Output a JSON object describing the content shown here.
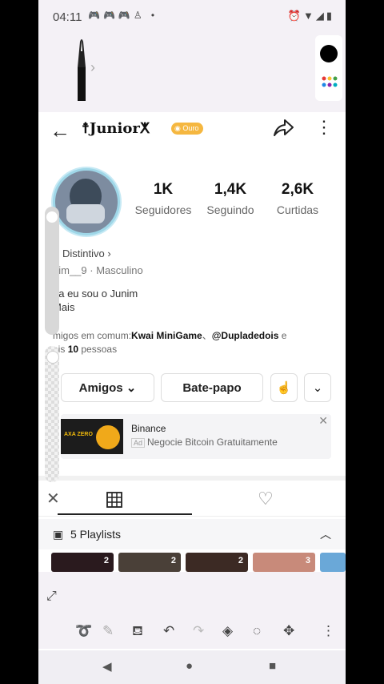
{
  "status": {
    "time": "04:11"
  },
  "header": {
    "name": "Junior",
    "badge": "Ouro"
  },
  "profile": {
    "stats": [
      {
        "value": "1K",
        "label": "Seguidores"
      },
      {
        "value": "1,4K",
        "label": "Seguindo"
      },
      {
        "value": "2,6K",
        "label": "Curtidas"
      }
    ],
    "tag": "Distintivo",
    "handle": "nim__9 · Masculino",
    "bio_line1": "pa eu sou o Junim",
    "bio_line2": "Mais",
    "mutual_prefix": "migos em comum:",
    "mutual_name1": "Kwai MiniGame",
    "mutual_sep": "、",
    "mutual_name2": "@Dupladedois",
    "mutual_tail": " e",
    "mutual_line2_prefix": "ais ",
    "mutual_count": "10",
    "mutual_line2_suffix": " pessoas"
  },
  "actions": {
    "friends": "Amigos",
    "chat": "Bate-papo"
  },
  "ad": {
    "title": "Binance",
    "tag": "Ad",
    "description": "Negocie Bitcoin Gratuitamente",
    "thumb_text": "AXA ZERO"
  },
  "playlists": {
    "label": "5 Playlists",
    "counts": [
      "2",
      "2",
      "2",
      "3"
    ]
  }
}
